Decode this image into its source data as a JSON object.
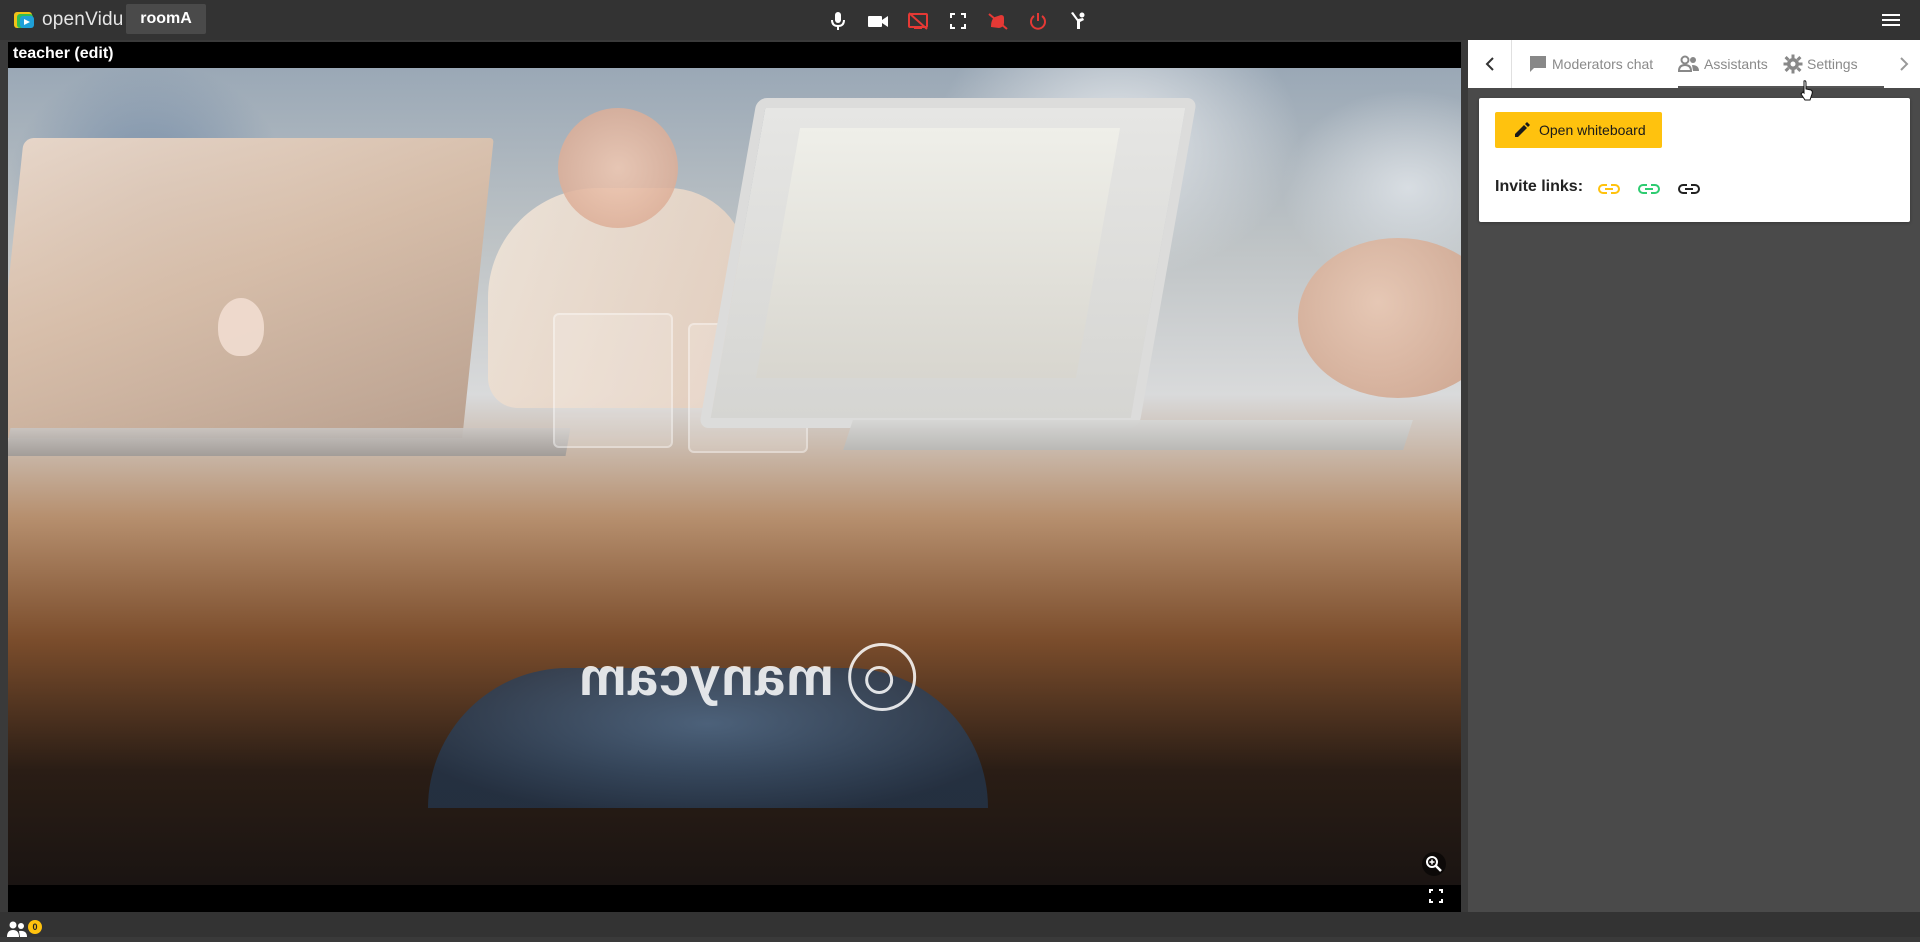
{
  "app": {
    "logo_text": "openVidu",
    "room_name": "roomA"
  },
  "toolbar": {
    "buttons": [
      {
        "icon": "mic-icon",
        "color": "#ffffff"
      },
      {
        "icon": "camera-icon",
        "color": "#ffffff"
      },
      {
        "icon": "screen-share-off-icon",
        "color": "#e53935"
      },
      {
        "icon": "fullscreen-icon",
        "color": "#ffffff"
      },
      {
        "icon": "hand-off-icon",
        "color": "#e53935"
      },
      {
        "icon": "power-icon",
        "color": "#e53935"
      },
      {
        "icon": "raise-hand-icon",
        "color": "#ffffff"
      }
    ]
  },
  "video": {
    "title": "teacher (edit)",
    "watermark": "manycam"
  },
  "sidebar": {
    "tabs": [
      {
        "label": "Moderators chat",
        "icon": "chat-icon"
      },
      {
        "label": "Assistants",
        "icon": "people-icon"
      },
      {
        "label": "Settings",
        "icon": "gear-icon",
        "active": true
      }
    ],
    "settings": {
      "whiteboard_button": "Open whiteboard",
      "invite_label": "Invite links:",
      "invite_links": [
        {
          "icon": "link-icon",
          "color": "#ffc20e"
        },
        {
          "icon": "link-icon",
          "color": "#2ecc71"
        },
        {
          "icon": "link-icon",
          "color": "#222222"
        }
      ]
    }
  },
  "bottom": {
    "participants_badge": "0"
  },
  "colors": {
    "topbar": "#333333",
    "accent": "#ffc20e",
    "danger": "#e53935"
  }
}
